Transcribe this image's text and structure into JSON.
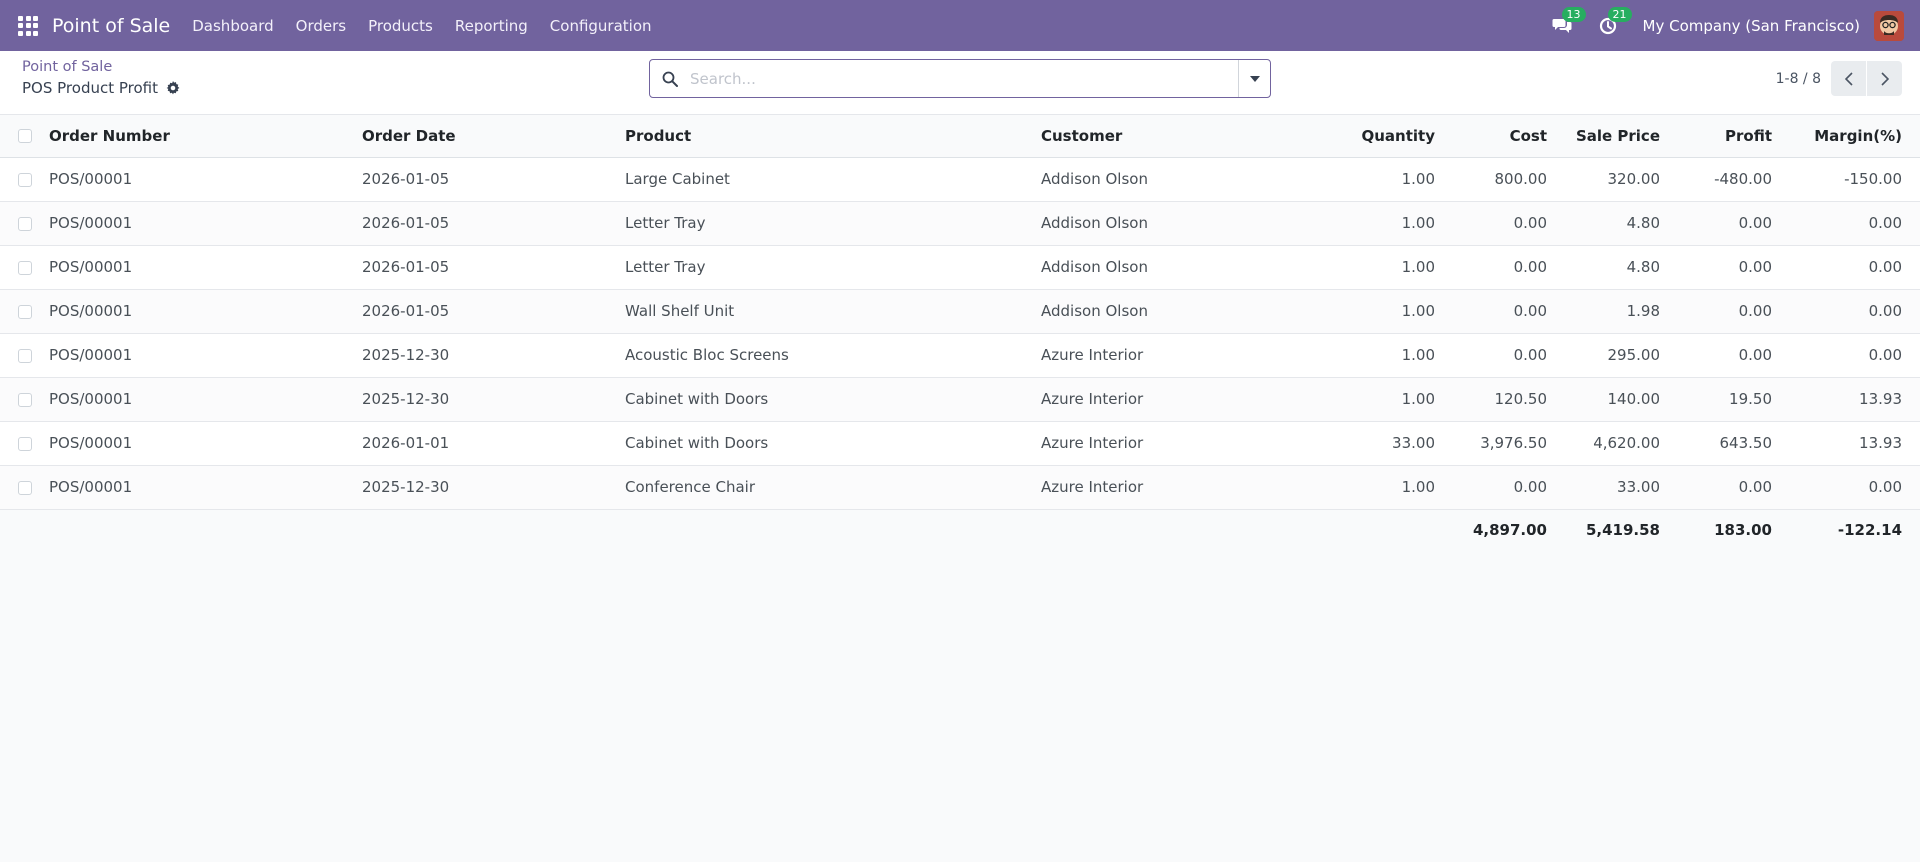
{
  "app": {
    "title": "Point of Sale",
    "menu": [
      "Dashboard",
      "Orders",
      "Products",
      "Reporting",
      "Configuration"
    ],
    "messages_count": "13",
    "activities_count": "21",
    "company": "My Company (San Francisco)",
    "accent_color": "#71639e"
  },
  "control": {
    "breadcrumb_parent": "Point of Sale",
    "breadcrumb_current": "POS Product Profit",
    "search_placeholder": "Search...",
    "pager": "1-8 / 8"
  },
  "table": {
    "columns": [
      "Order Number",
      "Order Date",
      "Product",
      "Customer",
      "Quantity",
      "Cost",
      "Sale Price",
      "Profit",
      "Margin(%)"
    ],
    "rows": [
      [
        "POS/00001",
        "2026-01-05",
        "Large Cabinet",
        "Addison Olson",
        "1.00",
        "800.00",
        "320.00",
        "-480.00",
        "-150.00"
      ],
      [
        "POS/00001",
        "2026-01-05",
        "Letter Tray",
        "Addison Olson",
        "1.00",
        "0.00",
        "4.80",
        "0.00",
        "0.00"
      ],
      [
        "POS/00001",
        "2026-01-05",
        "Letter Tray",
        "Addison Olson",
        "1.00",
        "0.00",
        "4.80",
        "0.00",
        "0.00"
      ],
      [
        "POS/00001",
        "2026-01-05",
        "Wall Shelf Unit",
        "Addison Olson",
        "1.00",
        "0.00",
        "1.98",
        "0.00",
        "0.00"
      ],
      [
        "POS/00001",
        "2025-12-30",
        "Acoustic Bloc Screens",
        "Azure Interior",
        "1.00",
        "0.00",
        "295.00",
        "0.00",
        "0.00"
      ],
      [
        "POS/00001",
        "2025-12-30",
        "Cabinet with Doors",
        "Azure Interior",
        "1.00",
        "120.50",
        "140.00",
        "19.50",
        "13.93"
      ],
      [
        "POS/00001",
        "2026-01-01",
        "Cabinet with Doors",
        "Azure Interior",
        "33.00",
        "3,976.50",
        "4,620.00",
        "643.50",
        "13.93"
      ],
      [
        "POS/00001",
        "2025-12-30",
        "Conference Chair",
        "Azure Interior",
        "1.00",
        "0.00",
        "33.00",
        "0.00",
        "0.00"
      ]
    ],
    "totals": {
      "cost": "4,897.00",
      "sale_price": "5,419.58",
      "profit": "183.00",
      "margin": "-122.14"
    }
  }
}
